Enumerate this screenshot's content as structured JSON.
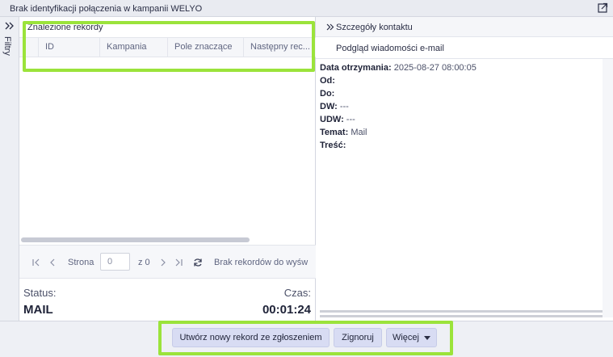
{
  "window": {
    "title": "Brak identyfikacji połączenia w kampanii WELYO"
  },
  "filters": {
    "label": "Filtry"
  },
  "records": {
    "title": "Znalezione rekordy",
    "columns": [
      "ID",
      "Kampania",
      "Pole znaczące",
      "Następny rec..."
    ],
    "rows": []
  },
  "pager": {
    "page_label": "Strona",
    "page_value": "0",
    "of_label": "z 0",
    "no_records": "Brak rekordów do wyśw"
  },
  "status": {
    "label": "Status:",
    "value": "MAIL",
    "time_label": "Czas:",
    "time_value": "00:01:24"
  },
  "contact": {
    "title": "Szczegóły kontaktu",
    "email_tab": "Podgląd wiadomości e-mail",
    "fields": [
      {
        "label": "Data otrzymania:",
        "value": "2025-08-27 08:00:05"
      },
      {
        "label": "Od:",
        "value": ""
      },
      {
        "label": "Do:",
        "value": ""
      },
      {
        "label": "DW:",
        "value": "---"
      },
      {
        "label": "UDW:",
        "value": "---"
      },
      {
        "label": "Temat:",
        "value": "Mail"
      },
      {
        "label": "Treść:",
        "value": ""
      }
    ]
  },
  "actions": {
    "create_label": "Utwórz nowy rekord ze zgłoszeniem",
    "ignore_label": "Zignoruj",
    "more_label": "Więcej"
  },
  "colors": {
    "highlight": "#9be33b",
    "button_bg": "#d8dcf3"
  }
}
